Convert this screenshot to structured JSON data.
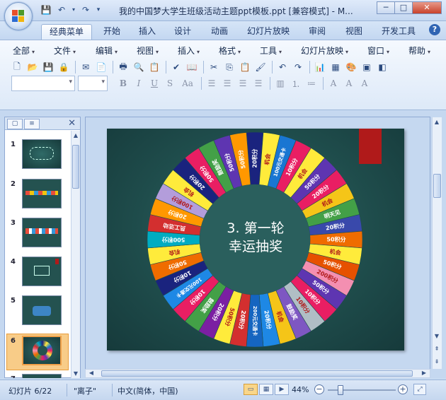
{
  "window": {
    "title": "我的中国梦大学生班级活动主题ppt模板.ppt [兼容模式] - M...",
    "minimize_label": "─",
    "maximize_label": "□",
    "close_label": "✕"
  },
  "ribbon_tabs": [
    "经典菜单",
    "开始",
    "插入",
    "设计",
    "动画",
    "幻灯片放映",
    "审阅",
    "视图",
    "开发工具"
  ],
  "active_tab": "经典菜单",
  "help_label": "?",
  "classic_menu": [
    "全部",
    "文件",
    "编辑",
    "视图",
    "插入",
    "格式",
    "工具",
    "幻灯片放映",
    "窗口",
    "帮助"
  ],
  "format_buttons": {
    "bold": "B",
    "italic": "I",
    "underline": "U",
    "strike": "S",
    "change_case": "Aa"
  },
  "slide_panel": {
    "thumbnails": [
      {
        "num": "1"
      },
      {
        "num": "2"
      },
      {
        "num": "3"
      },
      {
        "num": "4"
      },
      {
        "num": "5"
      },
      {
        "num": "6"
      },
      {
        "num": "7"
      }
    ],
    "selected": "6",
    "close_label": "✕"
  },
  "slide": {
    "center_title": "3. 第一轮 幸运抽奖",
    "center_line1": "3. 第一轮",
    "center_line2": "幸运抽奖",
    "background": "#1f4d4c",
    "accent": "#b01a1a",
    "wheel_segments": [
      {
        "label": "20积分",
        "color": "#1a237e"
      },
      {
        "label": "机会",
        "color": "#ffeb3b"
      },
      {
        "label": "100元交通卡",
        "color": "#1976d2"
      },
      {
        "label": "10积分",
        "color": "#e91e63"
      },
      {
        "label": "机会",
        "color": "#ffeb3b"
      },
      {
        "label": "50积分",
        "color": "#5e35b1"
      },
      {
        "label": "20积分",
        "color": "#e91e63"
      },
      {
        "label": "机会",
        "color": "#f5c518"
      },
      {
        "label": "明天见",
        "color": "#43a047"
      },
      {
        "label": "20积分",
        "color": "#3949ab"
      },
      {
        "label": "50积分",
        "color": "#ef6c00"
      },
      {
        "label": "机会",
        "color": "#ffeb3b"
      },
      {
        "label": "50积分",
        "color": "#e65100"
      },
      {
        "label": "200积分",
        "color": "#f48fb1"
      },
      {
        "label": "50积分",
        "color": "#5e35b1"
      },
      {
        "label": "10积分",
        "color": "#e91e63"
      },
      {
        "label": "10积分",
        "color": "#b0bec5"
      },
      {
        "label": "鼓励奖",
        "color": "#7e57c2"
      },
      {
        "label": "机会",
        "color": "#f5c518"
      },
      {
        "label": "20积分",
        "color": "#1e88e5"
      },
      {
        "label": "200元交通卡",
        "color": "#1565c0"
      },
      {
        "label": "20积分",
        "color": "#d32f2f"
      },
      {
        "label": "50积分",
        "color": "#ffeb3b"
      },
      {
        "label": "20积分",
        "color": "#7b1fa2"
      },
      {
        "label": "鼓励奖",
        "color": "#43a047"
      },
      {
        "label": "10积分",
        "color": "#e91e63"
      },
      {
        "label": "100元交通卡",
        "color": "#1e88e5"
      },
      {
        "label": "10积分",
        "color": "#1a237e"
      },
      {
        "label": "50积分",
        "color": "#ef6c00"
      },
      {
        "label": "机会",
        "color": "#ffeb3b"
      },
      {
        "label": "500积分",
        "color": "#00acc1"
      },
      {
        "label": "员工活动",
        "color": "#d32f2f"
      },
      {
        "label": "20积分",
        "color": "#ff9800"
      },
      {
        "label": "100积分",
        "color": "#b39ddb"
      },
      {
        "label": "机会",
        "color": "#ffeb3b"
      },
      {
        "label": "20积分",
        "color": "#1a237e"
      },
      {
        "label": "50积分",
        "color": "#e91e63"
      },
      {
        "label": "鼓励奖",
        "color": "#43a047"
      },
      {
        "label": "50积分",
        "color": "#5e35b1"
      },
      {
        "label": "50积分",
        "color": "#ff9800"
      }
    ]
  },
  "status": {
    "slide_info": "幻灯片 6/22",
    "theme": "\"离子\"",
    "language": "中文(简体，中国)",
    "zoom": "44%",
    "zoom_level_pct": 44
  }
}
